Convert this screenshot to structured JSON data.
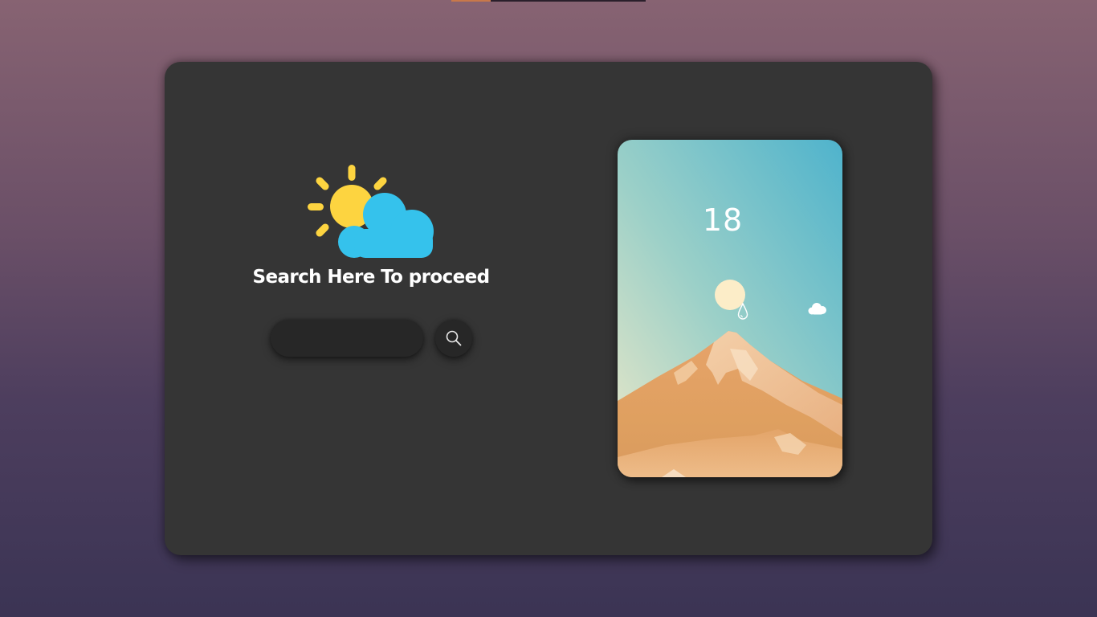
{
  "heading": "Search Here To proceed",
  "search": {
    "placeholder": "",
    "value": ""
  },
  "weather_card": {
    "temperature": "18"
  },
  "icons": {
    "main": "sun-behind-cloud-icon",
    "search": "search-icon",
    "sun": "sun-icon",
    "drop": "raindrop-icon",
    "cloud": "cloud-icon"
  },
  "colors": {
    "sun_yellow": "#fdd440",
    "cloud_blue": "#35c2ec",
    "panel": "#353535",
    "input": "#272727"
  }
}
